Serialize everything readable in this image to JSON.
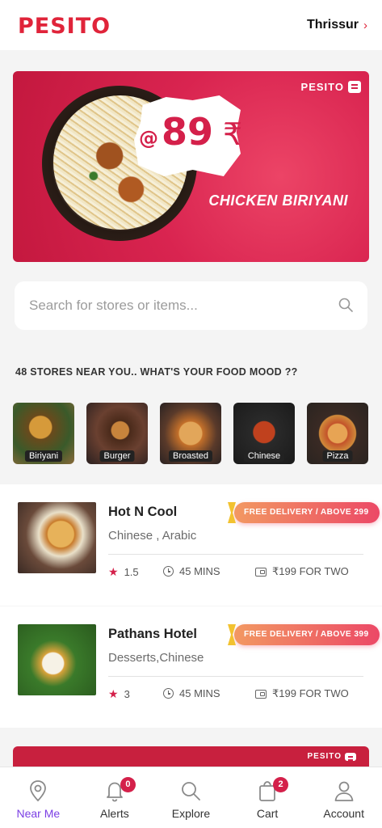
{
  "header": {
    "logo": "PESITO",
    "city": "Thrissur"
  },
  "banner": {
    "brand": "PESITO",
    "price_prefix": "@",
    "price": "89",
    "currency": "₹",
    "dish": "CHICKEN BIRIYANI"
  },
  "search": {
    "placeholder": "Search for stores or items..."
  },
  "section_title": "48 STORES NEAR YOU.. WHAT'S YOUR FOOD MOOD ??",
  "categories": [
    {
      "label": "Biriyani"
    },
    {
      "label": "Burger"
    },
    {
      "label": "Broasted"
    },
    {
      "label": "Chinese"
    },
    {
      "label": "Pizza"
    }
  ],
  "stores": [
    {
      "name": "Hot N Cool",
      "cuisine": "Chinese , Arabic",
      "promo": "FREE DELIVERY / ABOVE 299",
      "rating": "1.5",
      "time": "45 MINS",
      "price_for_two": "₹199 FOR TWO"
    },
    {
      "name": "Pathans Hotel",
      "cuisine": "Desserts,Chinese",
      "promo": "FREE DELIVERY / ABOVE 399",
      "rating": "3",
      "time": "45 MINS",
      "price_for_two": "₹199 FOR TWO"
    }
  ],
  "banner2": {
    "brand": "PESITO"
  },
  "nav": [
    {
      "label": "Near Me",
      "icon": "location-pin-icon",
      "active": true
    },
    {
      "label": "Alerts",
      "icon": "bell-icon",
      "badge": "0"
    },
    {
      "label": "Explore",
      "icon": "search-icon"
    },
    {
      "label": "Cart",
      "icon": "bag-icon",
      "badge": "2"
    },
    {
      "label": "Account",
      "icon": "user-icon"
    }
  ],
  "colors": {
    "brand": "#e0243a",
    "active_nav": "#7b3fe4",
    "banner": "#d92450"
  }
}
